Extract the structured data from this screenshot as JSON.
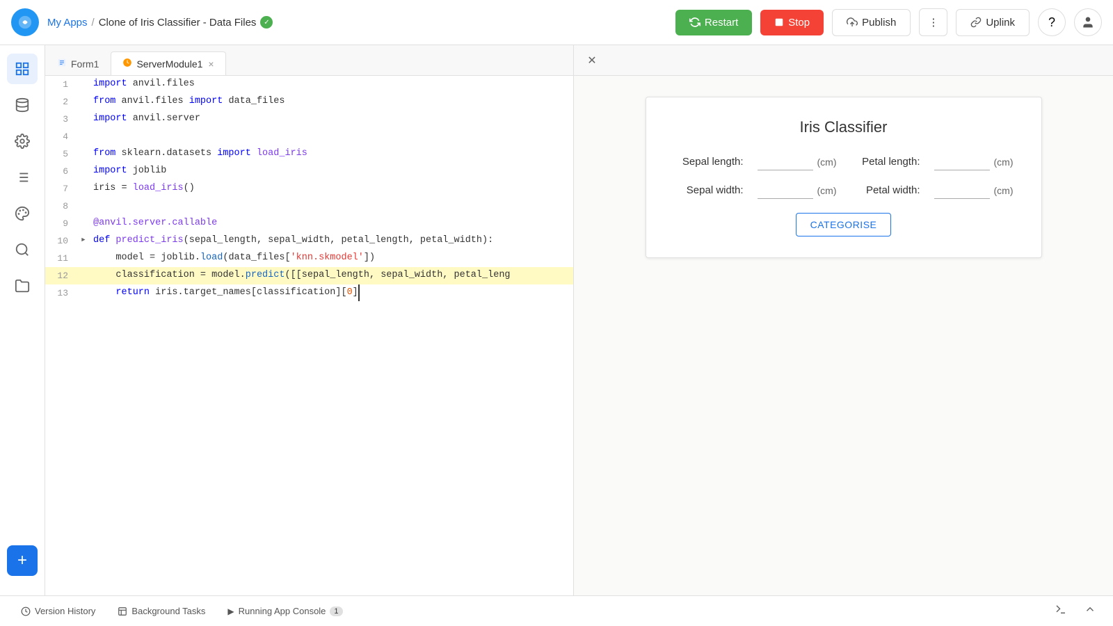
{
  "topbar": {
    "my_apps_label": "My Apps",
    "separator": "/",
    "app_name": "Clone of Iris Classifier - Data Files",
    "restart_label": "Restart",
    "stop_label": "Stop",
    "publish_label": "Publish",
    "uplink_label": "Uplink"
  },
  "tabs": [
    {
      "id": "form1",
      "label": "Form1",
      "type": "form",
      "active": false,
      "closeable": false
    },
    {
      "id": "server",
      "label": "ServerModule1",
      "type": "server",
      "active": true,
      "closeable": true
    }
  ],
  "code": {
    "lines": [
      {
        "num": 1,
        "content": "import anvil.files",
        "has_arrow": false,
        "highlighted": false
      },
      {
        "num": 2,
        "content": "from anvil.files import data_files",
        "has_arrow": false,
        "highlighted": false
      },
      {
        "num": 3,
        "content": "import anvil.server",
        "has_arrow": false,
        "highlighted": false
      },
      {
        "num": 4,
        "content": "",
        "has_arrow": false,
        "highlighted": false
      },
      {
        "num": 5,
        "content": "from sklearn.datasets import load_iris",
        "has_arrow": false,
        "highlighted": false
      },
      {
        "num": 6,
        "content": "import joblib",
        "has_arrow": false,
        "highlighted": false
      },
      {
        "num": 7,
        "content": "iris = load_iris()",
        "has_arrow": false,
        "highlighted": false
      },
      {
        "num": 8,
        "content": "",
        "has_arrow": false,
        "highlighted": false
      },
      {
        "num": 9,
        "content": "@anvil.server.callable",
        "has_arrow": false,
        "highlighted": false
      },
      {
        "num": 10,
        "content": "def predict_iris(sepal_length, sepal_width, petal_length, petal_width):",
        "has_arrow": true,
        "highlighted": false
      },
      {
        "num": 11,
        "content": "    model = joblib.load(data_files['knn.skmodel'])",
        "has_arrow": false,
        "highlighted": false
      },
      {
        "num": 12,
        "content": "    classification = model.predict([[sepal_length, sepal_width, petal_leng",
        "has_arrow": false,
        "highlighted": true
      },
      {
        "num": 13,
        "content": "    return iris.target_names[classification][0]",
        "has_arrow": false,
        "highlighted": false
      }
    ]
  },
  "preview": {
    "app_title": "Iris Classifier",
    "fields": [
      {
        "label": "Sepal length:",
        "unit": "(cm)"
      },
      {
        "label": "Petal length:",
        "unit": "(cm)"
      },
      {
        "label": "Sepal width:",
        "unit": "(cm)"
      },
      {
        "label": "Petal width:",
        "unit": "(cm)"
      }
    ],
    "categorise_label": "CATEGORISE"
  },
  "bottom_tabs": [
    {
      "id": "version",
      "label": "Version History",
      "icon": "history",
      "badge": null
    },
    {
      "id": "background",
      "label": "Background Tasks",
      "icon": "tasks",
      "badge": null
    },
    {
      "id": "console",
      "label": "Running App Console",
      "icon": "terminal",
      "badge": "1"
    }
  ],
  "sidebar": {
    "items": [
      {
        "id": "grid",
        "icon": "⊞",
        "active": true
      },
      {
        "id": "database",
        "icon": "🗄",
        "active": false
      },
      {
        "id": "settings",
        "icon": "⚙",
        "active": false
      },
      {
        "id": "list",
        "icon": "☰",
        "active": false
      },
      {
        "id": "paint",
        "icon": "🎨",
        "active": false
      },
      {
        "id": "search",
        "icon": "🔍",
        "active": false
      },
      {
        "id": "folder",
        "icon": "📁",
        "active": false
      }
    ]
  }
}
